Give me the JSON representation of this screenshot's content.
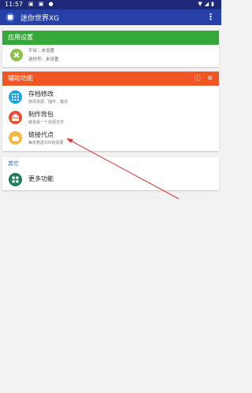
{
  "status_bar": {
    "time": "11:57"
  },
  "app_bar": {
    "title": "迷你世界XG"
  },
  "settings_card": {
    "header": "应用设置",
    "platform": "平台：未设置",
    "account": "迷你号：未设置"
  },
  "tools_card": {
    "header": "辅助功能",
    "items": [
      {
        "title": "存档修改",
        "subtitle": "修改资源、插件、模式",
        "color": "#1ba5dd"
      },
      {
        "title": "制作背包",
        "subtitle": "做道具一个资源文件",
        "color": "#e84d2f"
      },
      {
        "title": "链接代点",
        "subtitle": "每天赠送100道资源",
        "color": "#f6b73d"
      }
    ]
  },
  "other_card": {
    "header": "其它",
    "items": [
      {
        "title": "更多功能",
        "color": "#1b7d5d"
      }
    ]
  },
  "colors": {
    "status_bar": "#1e2a78",
    "app_bar": "#2740a8",
    "green": "#35a83a",
    "orange": "#f05523",
    "arrow": "#d63a3a"
  }
}
